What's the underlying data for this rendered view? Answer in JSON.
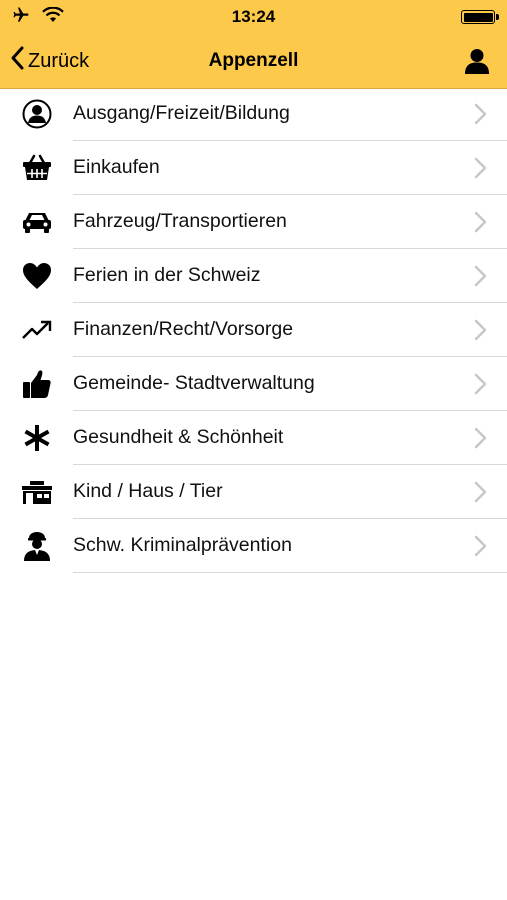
{
  "status_bar": {
    "time": "13:24",
    "icons": [
      "airplane-icon",
      "wifi-icon",
      "battery-icon"
    ]
  },
  "nav": {
    "back_label": "Zurück",
    "title": "Appenzell",
    "right_icon": "profile-icon"
  },
  "colors": {
    "header_bg": "#FDC94A",
    "separator": "#D8D8D8",
    "chevron": "#C7C7CC"
  },
  "categories": [
    {
      "label": "Ausgang/Freizeit/Bildung",
      "icon": "person-circle-icon"
    },
    {
      "label": "Einkaufen",
      "icon": "shopping-basket-icon"
    },
    {
      "label": "Fahrzeug/Transportieren",
      "icon": "car-icon"
    },
    {
      "label": "Ferien in der Schweiz",
      "icon": "heart-icon"
    },
    {
      "label": "Finanzen/Recht/Vorsorge",
      "icon": "trend-up-icon"
    },
    {
      "label": "Gemeinde- Stadtverwaltung",
      "icon": "thumbs-up-icon"
    },
    {
      "label": "Gesundheit & Schönheit",
      "icon": "asterisk-icon"
    },
    {
      "label": "Kind / Haus / Tier",
      "icon": "house-icon"
    },
    {
      "label": "Schw. Kriminalprävention",
      "icon": "police-officer-icon"
    }
  ]
}
